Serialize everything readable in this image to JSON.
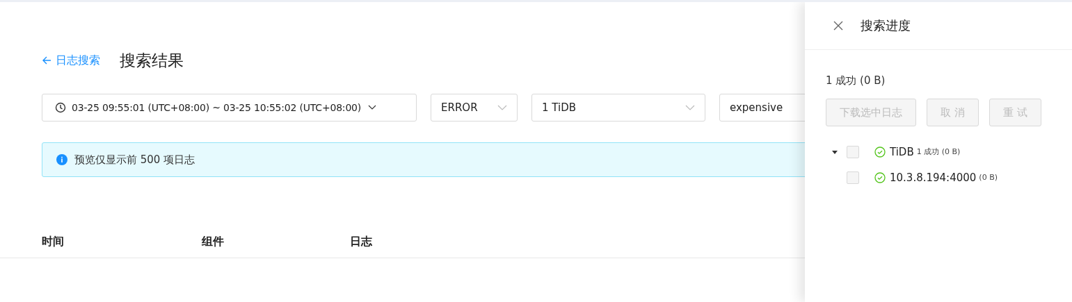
{
  "header": {
    "back_link": "日志搜索",
    "title": "搜索结果"
  },
  "filters": {
    "time_range": "03-25 09:55:01 (UTC+08:00) ~ 03-25 10:55:02 (UTC+08:00)",
    "level": "ERROR",
    "components": "1 TiDB",
    "keyword": "expensive"
  },
  "alert": "预览仅显示前 500 项日志",
  "table": {
    "columns": [
      "时间",
      "组件",
      "日志"
    ]
  },
  "drawer": {
    "title": "搜索进度",
    "summary": "1 成功 (0 B)",
    "buttons": [
      {
        "label": "下载选中日志",
        "disabled": true
      },
      {
        "label": "取 消",
        "disabled": true
      },
      {
        "label": "重 试",
        "disabled": true
      }
    ],
    "tree": [
      {
        "name": "TiDB",
        "detail": "1 成功 (0 B)",
        "kind": "success",
        "checked": false,
        "expanded": true,
        "children": [
          {
            "name": "10.3.8.194:4000",
            "detail": "(0 B)",
            "kind": "success",
            "checked": false
          }
        ]
      }
    ]
  }
}
